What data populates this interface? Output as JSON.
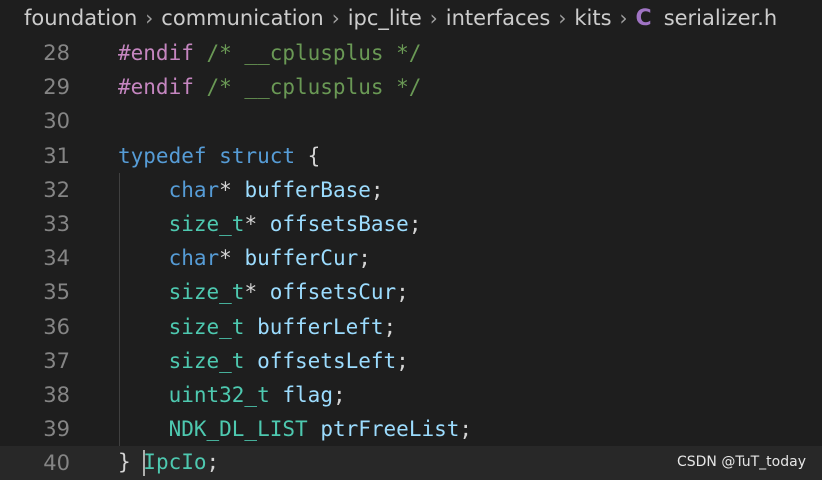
{
  "breadcrumb": {
    "items": [
      "foundation",
      "communication",
      "ipc_lite",
      "interfaces",
      "kits"
    ],
    "file_icon": "C",
    "file": "serializer.h"
  },
  "lines": [
    {
      "num": "28",
      "tokens": [
        {
          "t": "#endif",
          "c": "pre"
        },
        {
          "t": " /* __cplusplus */",
          "c": "com"
        }
      ]
    },
    {
      "num": "29",
      "tokens": [
        {
          "t": "#endif",
          "c": "pre"
        },
        {
          "t": " /* __cplusplus */",
          "c": "com"
        }
      ]
    },
    {
      "num": "30",
      "tokens": []
    },
    {
      "num": "31",
      "tokens": [
        {
          "t": "typedef",
          "c": "kw"
        },
        {
          "t": " ",
          "c": "punc"
        },
        {
          "t": "struct",
          "c": "kw"
        },
        {
          "t": " {",
          "c": "punc"
        }
      ]
    },
    {
      "num": "32",
      "tokens": [
        {
          "t": "    ",
          "c": "punc"
        },
        {
          "t": "char",
          "c": "kw"
        },
        {
          "t": "* ",
          "c": "punc"
        },
        {
          "t": "bufferBase",
          "c": "id"
        },
        {
          "t": ";",
          "c": "punc"
        }
      ]
    },
    {
      "num": "33",
      "tokens": [
        {
          "t": "    ",
          "c": "punc"
        },
        {
          "t": "size_t",
          "c": "type"
        },
        {
          "t": "* ",
          "c": "punc"
        },
        {
          "t": "offsetsBase",
          "c": "id"
        },
        {
          "t": ";",
          "c": "punc"
        }
      ]
    },
    {
      "num": "34",
      "tokens": [
        {
          "t": "    ",
          "c": "punc"
        },
        {
          "t": "char",
          "c": "kw"
        },
        {
          "t": "* ",
          "c": "punc"
        },
        {
          "t": "bufferCur",
          "c": "id"
        },
        {
          "t": ";",
          "c": "punc"
        }
      ]
    },
    {
      "num": "35",
      "tokens": [
        {
          "t": "    ",
          "c": "punc"
        },
        {
          "t": "size_t",
          "c": "type"
        },
        {
          "t": "* ",
          "c": "punc"
        },
        {
          "t": "offsetsCur",
          "c": "id"
        },
        {
          "t": ";",
          "c": "punc"
        }
      ]
    },
    {
      "num": "36",
      "tokens": [
        {
          "t": "    ",
          "c": "punc"
        },
        {
          "t": "size_t",
          "c": "type"
        },
        {
          "t": " ",
          "c": "punc"
        },
        {
          "t": "bufferLeft",
          "c": "id"
        },
        {
          "t": ";",
          "c": "punc"
        }
      ]
    },
    {
      "num": "37",
      "tokens": [
        {
          "t": "    ",
          "c": "punc"
        },
        {
          "t": "size_t",
          "c": "type"
        },
        {
          "t": " ",
          "c": "punc"
        },
        {
          "t": "offsetsLeft",
          "c": "id"
        },
        {
          "t": ";",
          "c": "punc"
        }
      ]
    },
    {
      "num": "38",
      "tokens": [
        {
          "t": "    ",
          "c": "punc"
        },
        {
          "t": "uint32_t",
          "c": "type"
        },
        {
          "t": " ",
          "c": "punc"
        },
        {
          "t": "flag",
          "c": "id"
        },
        {
          "t": ";",
          "c": "punc"
        }
      ]
    },
    {
      "num": "39",
      "tokens": [
        {
          "t": "    ",
          "c": "punc"
        },
        {
          "t": "NDK_DL_LIST",
          "c": "type"
        },
        {
          "t": " ",
          "c": "punc"
        },
        {
          "t": "ptrFreeList",
          "c": "id"
        },
        {
          "t": ";",
          "c": "punc"
        }
      ]
    },
    {
      "num": "40",
      "tokens": [
        {
          "t": "} ",
          "c": "punc"
        },
        {
          "t": "IpcIo",
          "c": "typename",
          "cursor": true
        },
        {
          "t": ";",
          "c": "punc"
        }
      ],
      "current": true
    }
  ],
  "watermark": "CSDN @TuT_today",
  "colors": {
    "background": "#1e1e1e",
    "line_number": "#858585",
    "keyword": "#569cd6",
    "type": "#4ec9b0",
    "identifier": "#9cdcfe",
    "comment": "#6a9955",
    "preprocessor": "#c586c0"
  }
}
